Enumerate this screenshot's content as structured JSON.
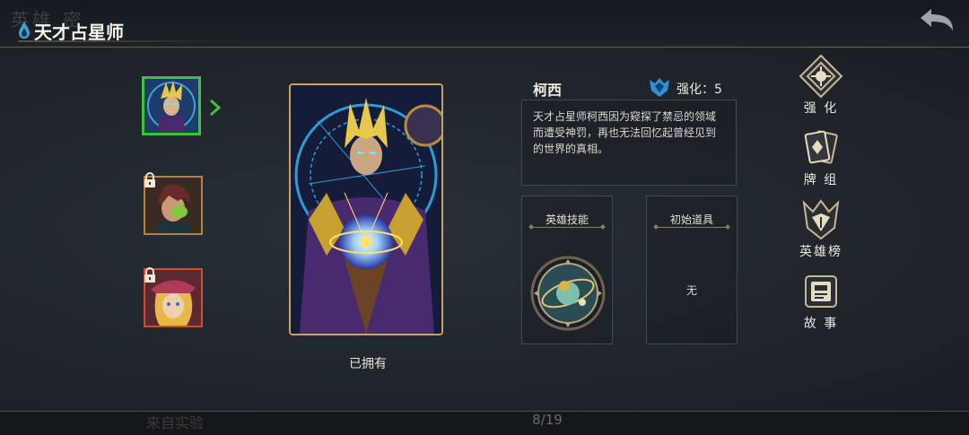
{
  "header": {
    "title": "天才占星师",
    "ghost_title": "英雄   密"
  },
  "heroes": [
    {
      "name": "柯西",
      "selected": true,
      "locked": false
    },
    {
      "name": "",
      "selected": false,
      "locked": true
    },
    {
      "name": "",
      "selected": false,
      "locked": true
    }
  ],
  "card": {
    "status": "已拥有"
  },
  "detail": {
    "name": "柯西",
    "enhance_label": "强化：5",
    "description": "天才占星师柯西因为窥探了禁忌的领域而遭受神罚，再也无法回忆起曾经见到的世界的真相。",
    "skill_title": "英雄技能",
    "item_title": "初始道具",
    "item_value": "无"
  },
  "side_menu": {
    "enhance": "强 化",
    "deck": "牌 组",
    "ranking": "英雄榜",
    "story": "故 事"
  },
  "footer": {
    "page": "8/19",
    "ghost_button": "来自实验"
  },
  "colors": {
    "accent_gold": "#c8a262",
    "selected_green": "#3fc23a",
    "rune_blue": "#2f9bd8",
    "robe_purple": "#4a2a6e"
  }
}
